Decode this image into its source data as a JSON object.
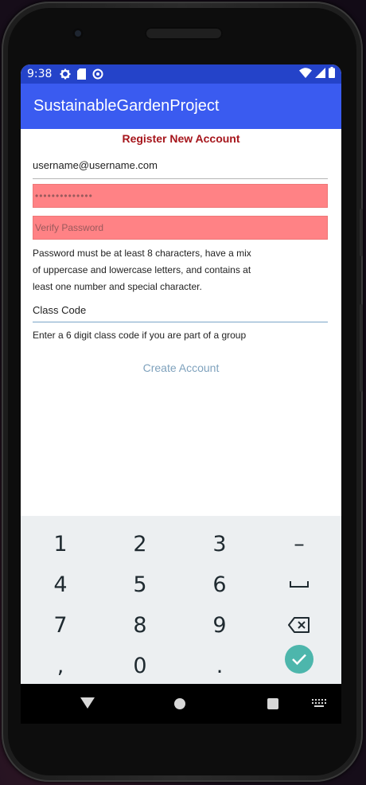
{
  "status_bar": {
    "time": "9:38",
    "left_icons": [
      "gear-icon",
      "sd-card-icon",
      "sync-icon"
    ],
    "right_icons": [
      "wifi-icon",
      "signal-icon",
      "battery-icon"
    ]
  },
  "app_bar": {
    "title": "SustainableGardenProject"
  },
  "form": {
    "heading": "Register New Account",
    "email_value": "username@username.com",
    "password_value": "••••••••••••••",
    "verify_placeholder": "Verify Password",
    "password_help": [
      "Password must be at least 8 characters, have a mix",
      "of uppercase and lowercase letters, and contains at",
      "least one number and special character."
    ],
    "class_code_placeholder": "Class Code",
    "class_code_hint": "Enter a 6 digit class code if you are part of a group",
    "create_button": "Create Account"
  },
  "keyboard": {
    "rows": [
      [
        "1",
        "2",
        "3",
        "–"
      ],
      [
        "4",
        "5",
        "6",
        "space"
      ],
      [
        "7",
        "8",
        "9",
        "backspace"
      ],
      [
        ",",
        "0",
        ".",
        "enter"
      ]
    ]
  },
  "colors": {
    "status_bar": "#2443c9",
    "app_bar": "#3a5bf0",
    "heading": "#a6161c",
    "error_field": "#ff8285",
    "link": "#7fa2bd",
    "enter_key": "#4db6ac"
  }
}
